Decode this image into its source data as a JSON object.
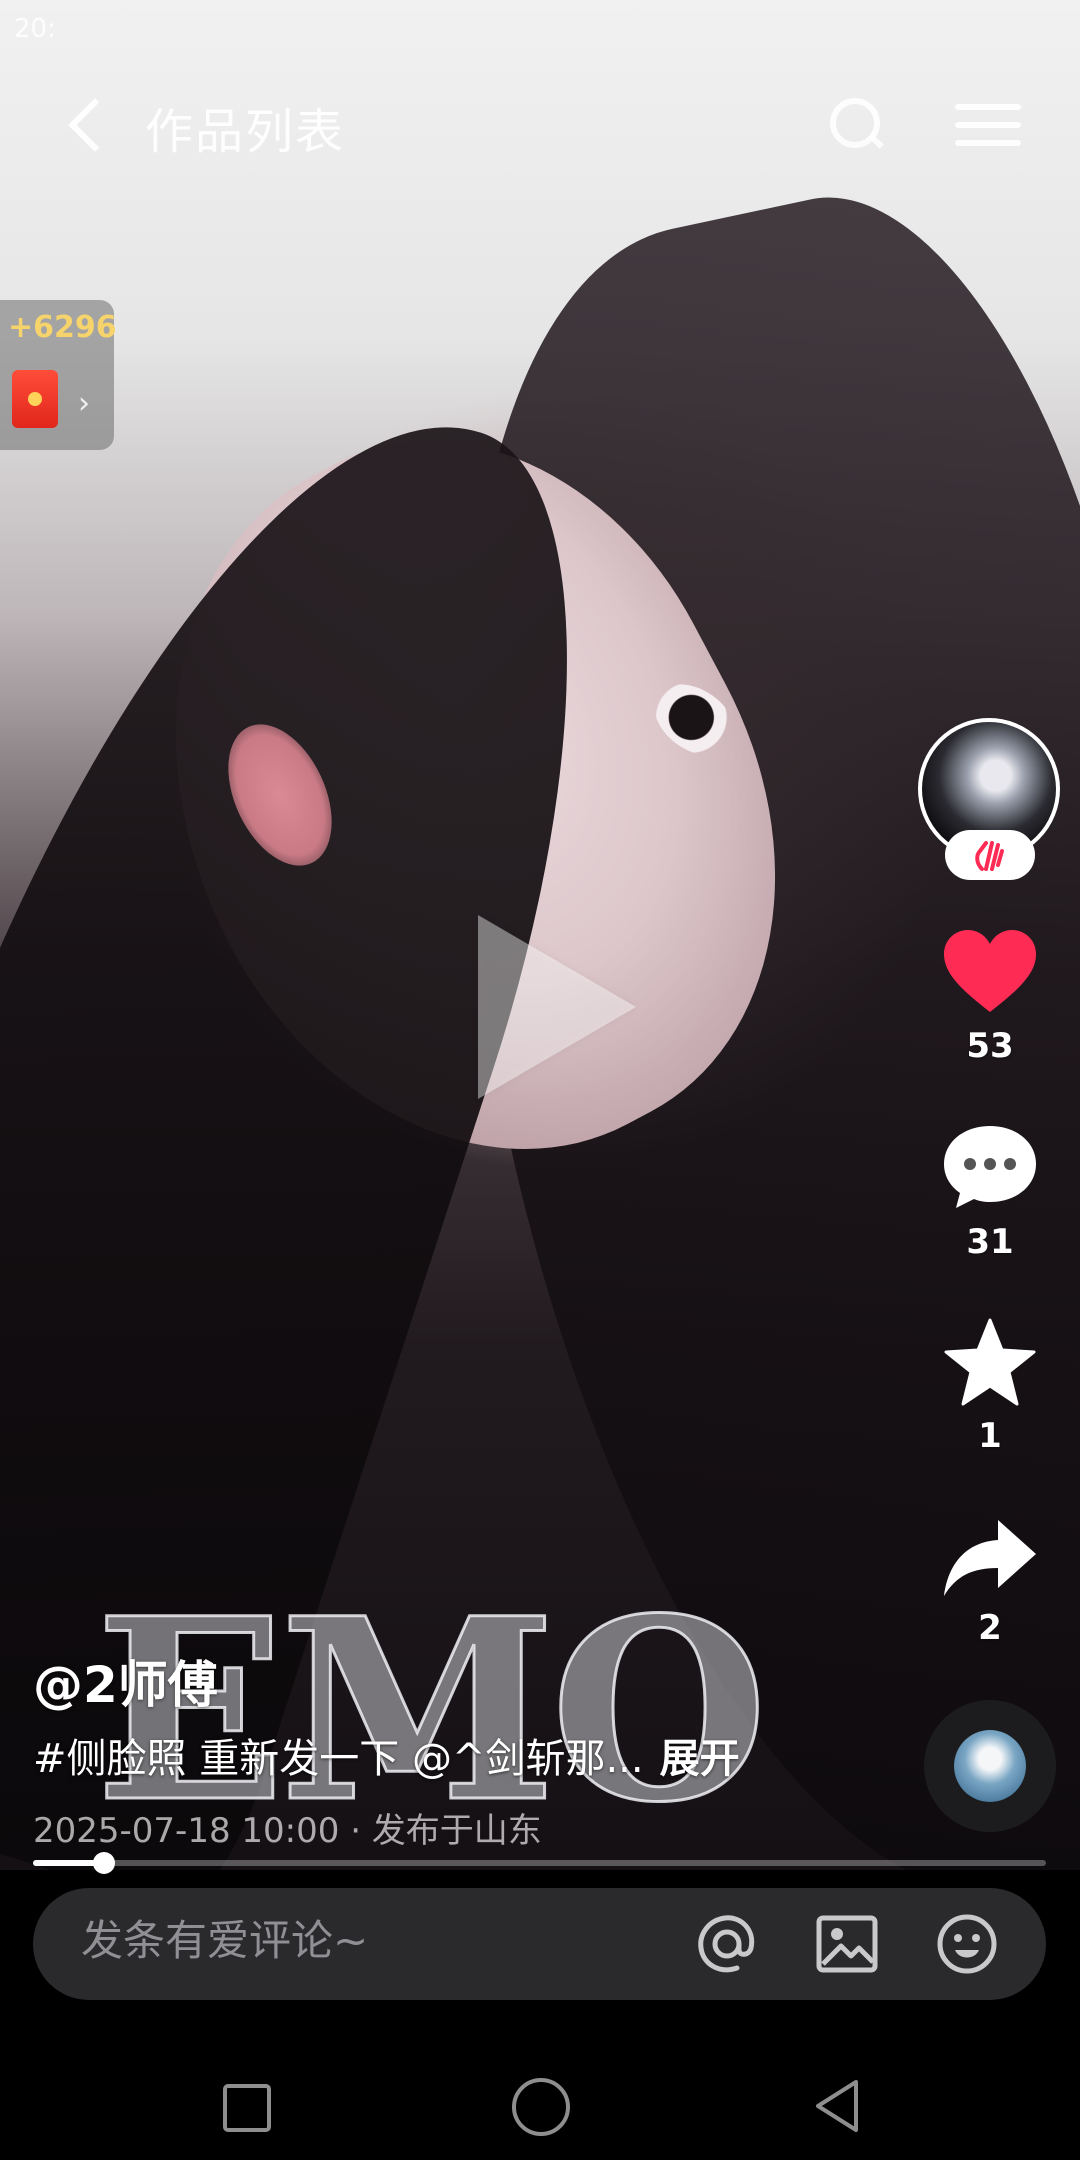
{
  "status_bar": {
    "time": "20:"
  },
  "top_nav": {
    "title": "作品列表"
  },
  "reward": {
    "amount": "+6296",
    "arrow": "›"
  },
  "actions": {
    "like_count": "53",
    "comment_count": "31",
    "favorite_count": "1",
    "share_count": "2"
  },
  "video": {
    "overlay_text": "EMO",
    "progress_fraction": 0.07
  },
  "caption": {
    "author": "@2师傅",
    "text": "#侧脸照 重新发一下 @^剑斩那...",
    "expand": "展开",
    "meta": "2025-07-18 10:00 · 发布于山东"
  },
  "comment_bar": {
    "placeholder": "发条有爱评论~"
  },
  "colors": {
    "like": "#fe2c55",
    "reward_text": "#f6d46b"
  },
  "icons": {
    "back": "back-icon",
    "search": "search-icon",
    "more": "more-icon",
    "like": "heart-icon",
    "comment": "comment-icon",
    "favorite": "star-icon",
    "share": "share-icon",
    "mention": "at-icon",
    "image": "image-icon",
    "emoji": "emoji-icon"
  }
}
